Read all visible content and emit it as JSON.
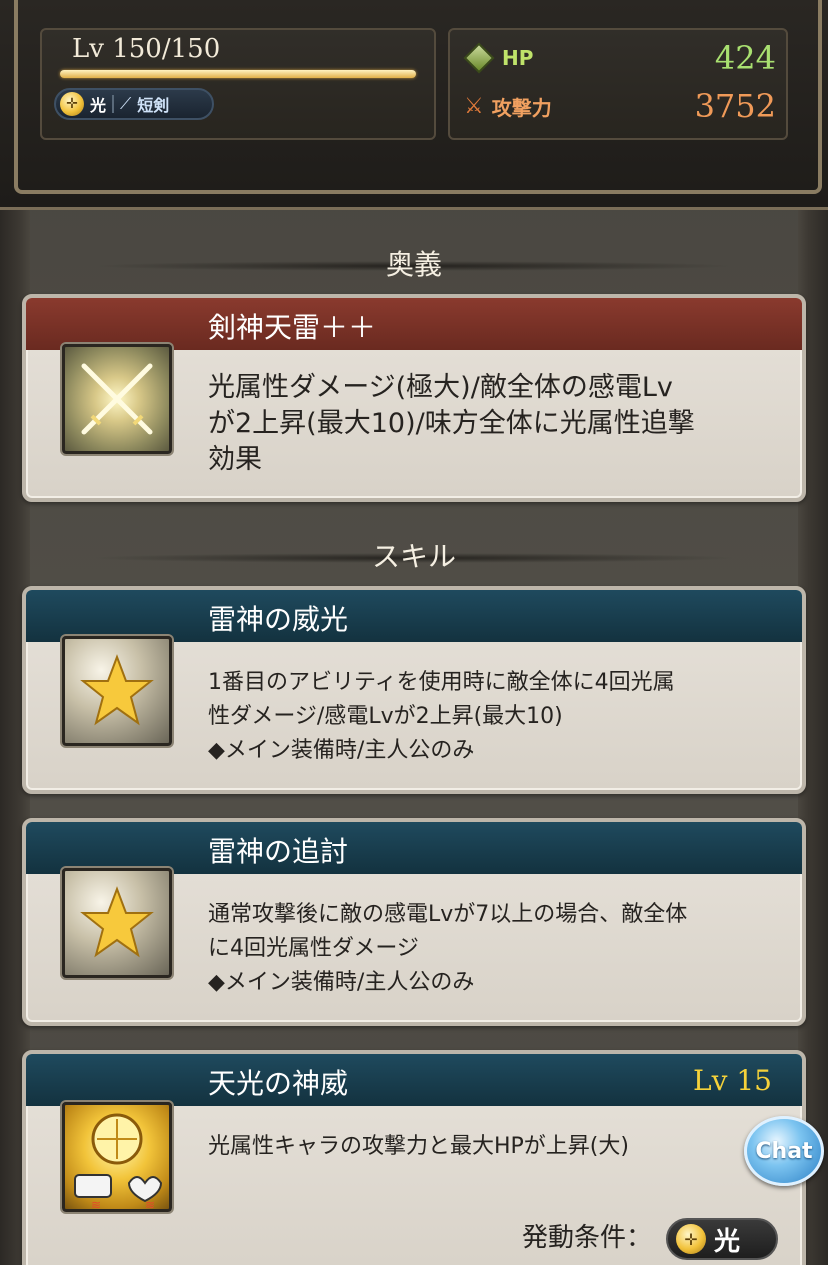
{
  "status": {
    "level": "Lv 150/150",
    "element": "光",
    "weapon": "短剣",
    "hp_label": "HP",
    "hp_value": "424",
    "atk_label": "攻撃力",
    "atk_value": "3752",
    "level_progress": 1.0
  },
  "sections": {
    "ougi": "奥義",
    "skill": "スキル"
  },
  "ougi": {
    "name": "剣神天雷＋＋",
    "lines": [
      "光属性ダメージ(極大)/敵全体の感電Lv",
      "が2上昇(最大10)/味方全体に光属性追撃",
      "効果"
    ],
    "icon": "crossed-swords-icon"
  },
  "skills": [
    {
      "name": "雷神の威光",
      "lines": [
        "1番目のアビリティを使用時に敵全体に4回光属",
        "性ダメージ/感電Lvが2上昇(最大10)",
        "◆メイン装備時/主人公のみ"
      ],
      "icon": "star-icon"
    },
    {
      "name": "雷神の追討",
      "lines": [
        "通常攻撃後に敵の感電Lvが7以上の場合、敵全体",
        "に4回光属性ダメージ",
        "◆メイン装備時/主人公のみ"
      ],
      "icon": "star-icon"
    },
    {
      "name": "天光の神威",
      "level": "Lv 15",
      "lines": [
        "光属性キャラの攻撃力と最大HPが上昇(大)"
      ],
      "condition_label": "発動条件：",
      "condition_value": "光",
      "icon": "light-attack-hp-up-icon"
    }
  ],
  "chat": {
    "label": "Chat"
  },
  "colors": {
    "ougi_header": "#8a3a2e",
    "skill_header": "#1f4a5e",
    "hp": "#a9e070",
    "atk": "#f09a58",
    "lv_gold": "#f5d23a"
  }
}
